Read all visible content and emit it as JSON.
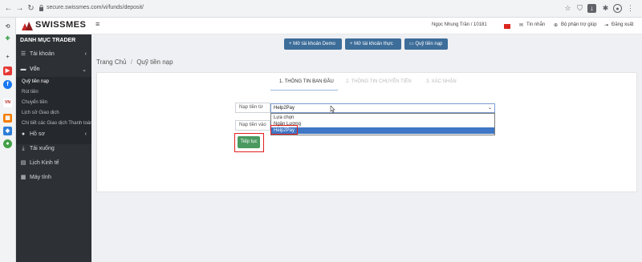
{
  "browser": {
    "url": "secure.swissmes.com/vi/funds/deposit/",
    "nav_icons": [
      "back-icon",
      "forward-icon",
      "reload-icon"
    ],
    "right_icons": [
      "star-icon",
      "shield-icon",
      "download-icon",
      "puzzle-icon",
      "profile-icon",
      "menu-icon"
    ]
  },
  "extensions": [
    "history-icon",
    "gamepad-icon",
    "plus-icon",
    "youtube-icon",
    "facebook-icon",
    "vnexpress-icon",
    "apps-icon",
    "game-icon",
    "settings-icon"
  ],
  "sidebar": {
    "logo": "SWISSMES",
    "heading": "DANH MỤC TRADER",
    "items": [
      {
        "label": "Tài khoản",
        "icon": "list-icon",
        "chevron": "‹"
      },
      {
        "label": "Vốn",
        "icon": "wallet-icon",
        "chevron": "⌄"
      },
      {
        "label": "Hồ sơ",
        "icon": "user-icon",
        "chevron": "‹"
      },
      {
        "label": "Tải xuống",
        "icon": "download-icon",
        "chevron": ""
      },
      {
        "label": "Lịch Kinh tế",
        "icon": "calendar-icon",
        "chevron": ""
      },
      {
        "label": "Máy tính",
        "icon": "calculator-icon",
        "chevron": ""
      }
    ],
    "submenu": [
      "Quỹ tiền nạp",
      "Rút tiền",
      "Chuyển tiền",
      "Lịch sử Giao dịch",
      "Chi tiết các Giao dịch Thanh toán"
    ]
  },
  "topbar": {
    "menu_icon": "≡",
    "user": "Ngọc Nhung Trần / 10181",
    "inbox": "Tin nhắn",
    "support": "Bộ phận trợ giúp",
    "logout": "Đăng xuất"
  },
  "actions": {
    "demo": "Mở tài khoản Demo",
    "real": "Mở tài khoản thực",
    "funds": "Quỹ tiền nạp"
  },
  "breadcrumb": {
    "home": "Trang Chủ",
    "sep": "/",
    "current": "Quỹ tiền nạp"
  },
  "steps": [
    {
      "label": "1. THÔNG TIN BAN ĐẦU",
      "active": true
    },
    {
      "label": "2. THÔNG TIN CHUYỂN TIỀN",
      "active": false
    },
    {
      "label": "3. XÁC NHẬN",
      "active": false
    }
  ],
  "form": {
    "deposit_from_label": "Nạp tiền từ",
    "deposit_to_label": "Nạp tiền vào",
    "selected_value": "Help2Pay",
    "options": [
      "Lựa chọn",
      "Ngân Lượng",
      "Help2Pay"
    ],
    "continue_label": "Tiếp tục"
  },
  "colors": {
    "accent": "#3d6d99",
    "success": "#4a9a60",
    "highlight": "#e02020",
    "sidebar_bg": "#2d3035"
  }
}
